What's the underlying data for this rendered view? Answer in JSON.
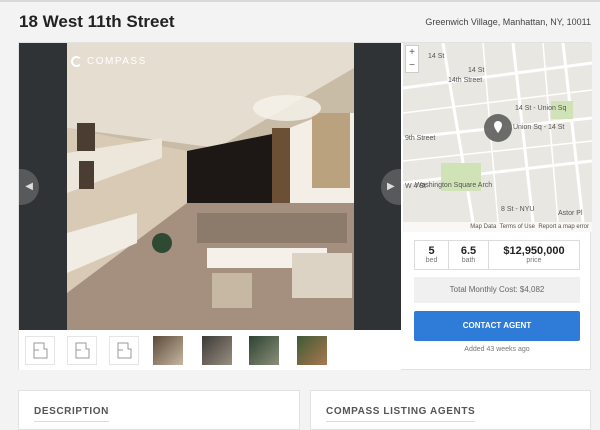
{
  "listing": {
    "address": "18 West 11th Street",
    "location": "Greenwich Village, Manhattan, NY, 10011"
  },
  "gallery": {
    "brand_label": "COMPASS",
    "prev_icon": "chevron-left-icon",
    "next_icon": "chevron-right-icon",
    "thumb_count": 7,
    "floorplan_icon": "floorplan-icon"
  },
  "map": {
    "zoom_in": "+",
    "zoom_out": "−",
    "marker_icon": "map-pin-icon",
    "labels": [
      "14 St",
      "14 St",
      "14th Street",
      "14 St - Union Sq",
      "Union Sq - 14 St",
      "9th Street",
      "W 4 St",
      "Washington Square Arch",
      "8 St - NYU",
      "Astor Pl"
    ],
    "footer": {
      "data": "Map Data",
      "terms": "Terms of Use",
      "report": "Report a map error"
    }
  },
  "stats": {
    "beds_value": "5",
    "beds_label": "bed",
    "baths_value": "6.5",
    "baths_label": "bath",
    "price_value": "$12,950,000",
    "price_label": "price"
  },
  "monthly_cost": "Total Monthly Cost: $4,082",
  "contact_button": "CONTACT AGENT",
  "added": "Added 43 weeks ago",
  "sections": {
    "description": "DESCRIPTION",
    "agents": "COMPASS LISTING AGENTS"
  },
  "colors": {
    "accent": "#2f7bd8",
    "photo_background": "#2f3336"
  }
}
